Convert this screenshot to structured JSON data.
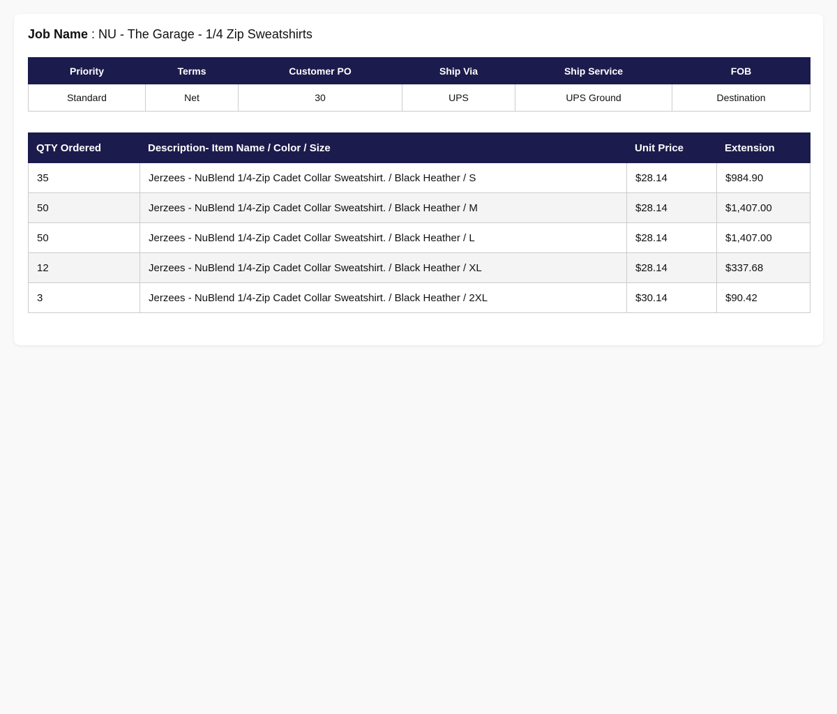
{
  "job": {
    "label": "Job Name",
    "separator": " : ",
    "value": "NU - The Garage - 1/4 Zip Sweatshirts"
  },
  "order_info": {
    "headers": [
      "Priority",
      "Terms",
      "Customer PO",
      "Ship Via",
      "Ship Service",
      "FOB"
    ],
    "values": [
      "Standard",
      "Net",
      "30",
      "UPS",
      "UPS Ground",
      "Destination"
    ]
  },
  "items": {
    "headers": [
      "QTY Ordered",
      "Description- Item Name / Color / Size",
      "Unit Price",
      "Extension"
    ],
    "rows": [
      {
        "qty": "35",
        "description": "Jerzees - NuBlend 1/4-Zip Cadet Collar Sweatshirt. / Black Heather / S",
        "unit_price": "$28.14",
        "extension": "$984.90"
      },
      {
        "qty": "50",
        "description": "Jerzees - NuBlend 1/4-Zip Cadet Collar Sweatshirt. / Black Heather / M",
        "unit_price": "$28.14",
        "extension": "$1,407.00"
      },
      {
        "qty": "50",
        "description": "Jerzees - NuBlend 1/4-Zip Cadet Collar Sweatshirt. / Black Heather / L",
        "unit_price": "$28.14",
        "extension": "$1,407.00"
      },
      {
        "qty": "12",
        "description": "Jerzees - NuBlend 1/4-Zip Cadet Collar Sweatshirt. / Black Heather / XL",
        "unit_price": "$28.14",
        "extension": "$337.68"
      },
      {
        "qty": "3",
        "description": "Jerzees - NuBlend 1/4-Zip Cadet Collar Sweatshirt. / Black Heather / 2XL",
        "unit_price": "$30.14",
        "extension": "$90.42"
      }
    ]
  },
  "colors": {
    "header_bg": "#1c1b4d",
    "page_bg": "#f9f9f9",
    "stripe_bg": "#f4f4f4"
  }
}
